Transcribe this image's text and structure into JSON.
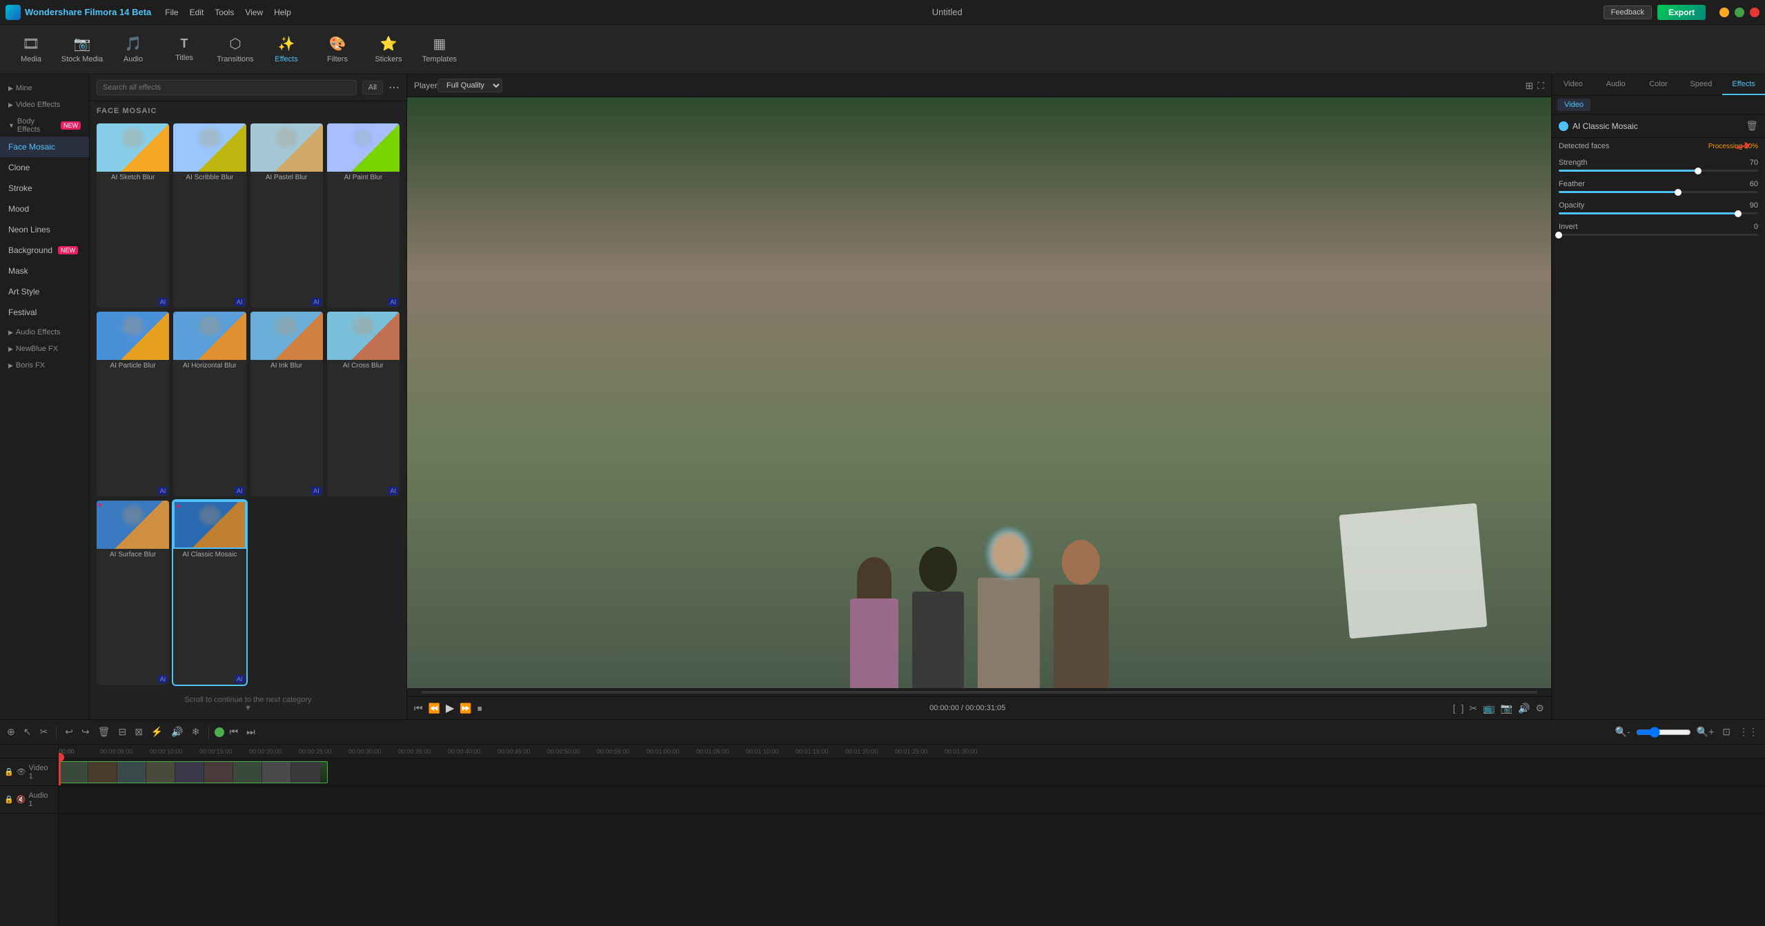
{
  "app": {
    "title": "Wondershare Filmora 14 Beta",
    "file_title": "Untitled"
  },
  "menu": {
    "items": [
      "File",
      "Edit",
      "Tools",
      "View",
      "Help"
    ]
  },
  "toolbar": {
    "items": [
      {
        "id": "media",
        "label": "Media",
        "icon": "🎞"
      },
      {
        "id": "stock",
        "label": "Stock Media",
        "icon": "📷"
      },
      {
        "id": "audio",
        "label": "Audio",
        "icon": "🎵"
      },
      {
        "id": "titles",
        "label": "Titles",
        "icon": "T"
      },
      {
        "id": "transitions",
        "label": "Transitions",
        "icon": "⬡"
      },
      {
        "id": "effects",
        "label": "Effects",
        "icon": "✨"
      },
      {
        "id": "filters",
        "label": "Filters",
        "icon": "🎨"
      },
      {
        "id": "stickers",
        "label": "Stickers",
        "icon": "⭐"
      },
      {
        "id": "templates",
        "label": "Templates",
        "icon": "▦"
      }
    ],
    "active": "effects"
  },
  "left_panel": {
    "sections": [
      {
        "label": "Mine",
        "items": []
      },
      {
        "label": "Video Effects",
        "items": []
      },
      {
        "label": "Body Effects",
        "badge": "NEW",
        "items": [
          "Face Mosaic",
          "Clone",
          "Stroke",
          "Mood",
          "Neon Lines",
          "Background",
          "Mask",
          "Art Style",
          "Festival"
        ]
      },
      {
        "label": "Audio Effects",
        "items": []
      },
      {
        "label": "NewBlue FX",
        "items": []
      },
      {
        "label": "Boris FX",
        "items": []
      }
    ]
  },
  "effects_panel": {
    "search_placeholder": "Search all effects",
    "filter_label": "All",
    "category_title": "FACE MOSAIC",
    "effects": [
      {
        "id": "sketch_blur",
        "label": "AI Sketch Blur",
        "thumb_class": "thumb-sketch"
      },
      {
        "id": "scribble_blur",
        "label": "AI Scribble Blur",
        "thumb_class": "thumb-scribble"
      },
      {
        "id": "pastel_blur",
        "label": "AI Pastel Blur",
        "thumb_class": "thumb-pastel"
      },
      {
        "id": "paint_blur",
        "label": "AI Paint Blur",
        "thumb_class": "thumb-paint"
      },
      {
        "id": "particle_blur",
        "label": "AI Particle Blur",
        "thumb_class": "thumb-particle"
      },
      {
        "id": "horizontal_blur",
        "label": "AI Horizontal Blur",
        "thumb_class": "thumb-horizontal"
      },
      {
        "id": "ink_blur",
        "label": "AI Ink Blur",
        "thumb_class": "thumb-ink"
      },
      {
        "id": "cross_blur",
        "label": "AI Cross Blur",
        "thumb_class": "thumb-cross"
      },
      {
        "id": "surface_blur",
        "label": "AI Surface Blur",
        "thumb_class": "thumb-surface"
      },
      {
        "id": "classic_mosaic",
        "label": "AI Classic Mosaic",
        "thumb_class": "thumb-classic",
        "selected": true
      }
    ],
    "scroll_hint": "Scroll to continue to the next category"
  },
  "preview": {
    "label": "Player",
    "quality": "Full Quality",
    "time_current": "00:00:00",
    "time_total": "00:00:31:05"
  },
  "right_panel": {
    "tabs": [
      "Video",
      "Audio",
      "Color",
      "Speed",
      "Effects"
    ],
    "active_tab": "Effects",
    "sub_tabs": [
      "Video"
    ],
    "active_sub_tab": "Video",
    "active_effect": "AI Classic Mosaic",
    "detected_label": "Detected faces",
    "processing_label": "Processing 20%",
    "sliders": [
      {
        "label": "Strength",
        "value": 70,
        "max": 100
      },
      {
        "label": "Feather",
        "value": 60,
        "max": 100
      },
      {
        "label": "Opacity",
        "value": 90,
        "max": 100
      },
      {
        "label": "Invert",
        "value": 0,
        "max": 100
      }
    ]
  },
  "timeline": {
    "tracks": [
      {
        "id": "video1",
        "label": "Video 1",
        "type": "video"
      },
      {
        "id": "audio1",
        "label": "Audio 1",
        "type": "audio"
      }
    ],
    "ruler_marks": [
      "00:00",
      "00:00:05:00",
      "00:00:10:00",
      "00:00:15:00",
      "00:00:20:00",
      "00:00:25:00",
      "00:00:30:00",
      "00:00:35:00",
      "00:00:40:00",
      "00:00:45:00",
      "00:00:50:00",
      "00:00:55:00",
      "00:01:00:00",
      "00:01:05:00",
      "00:01:10:00",
      "00:01:15:00",
      "00:01:20:00",
      "00:01:25:00",
      "00:01:30:00"
    ]
  },
  "feedback_btn": "Feedback",
  "export_btn": "Export"
}
